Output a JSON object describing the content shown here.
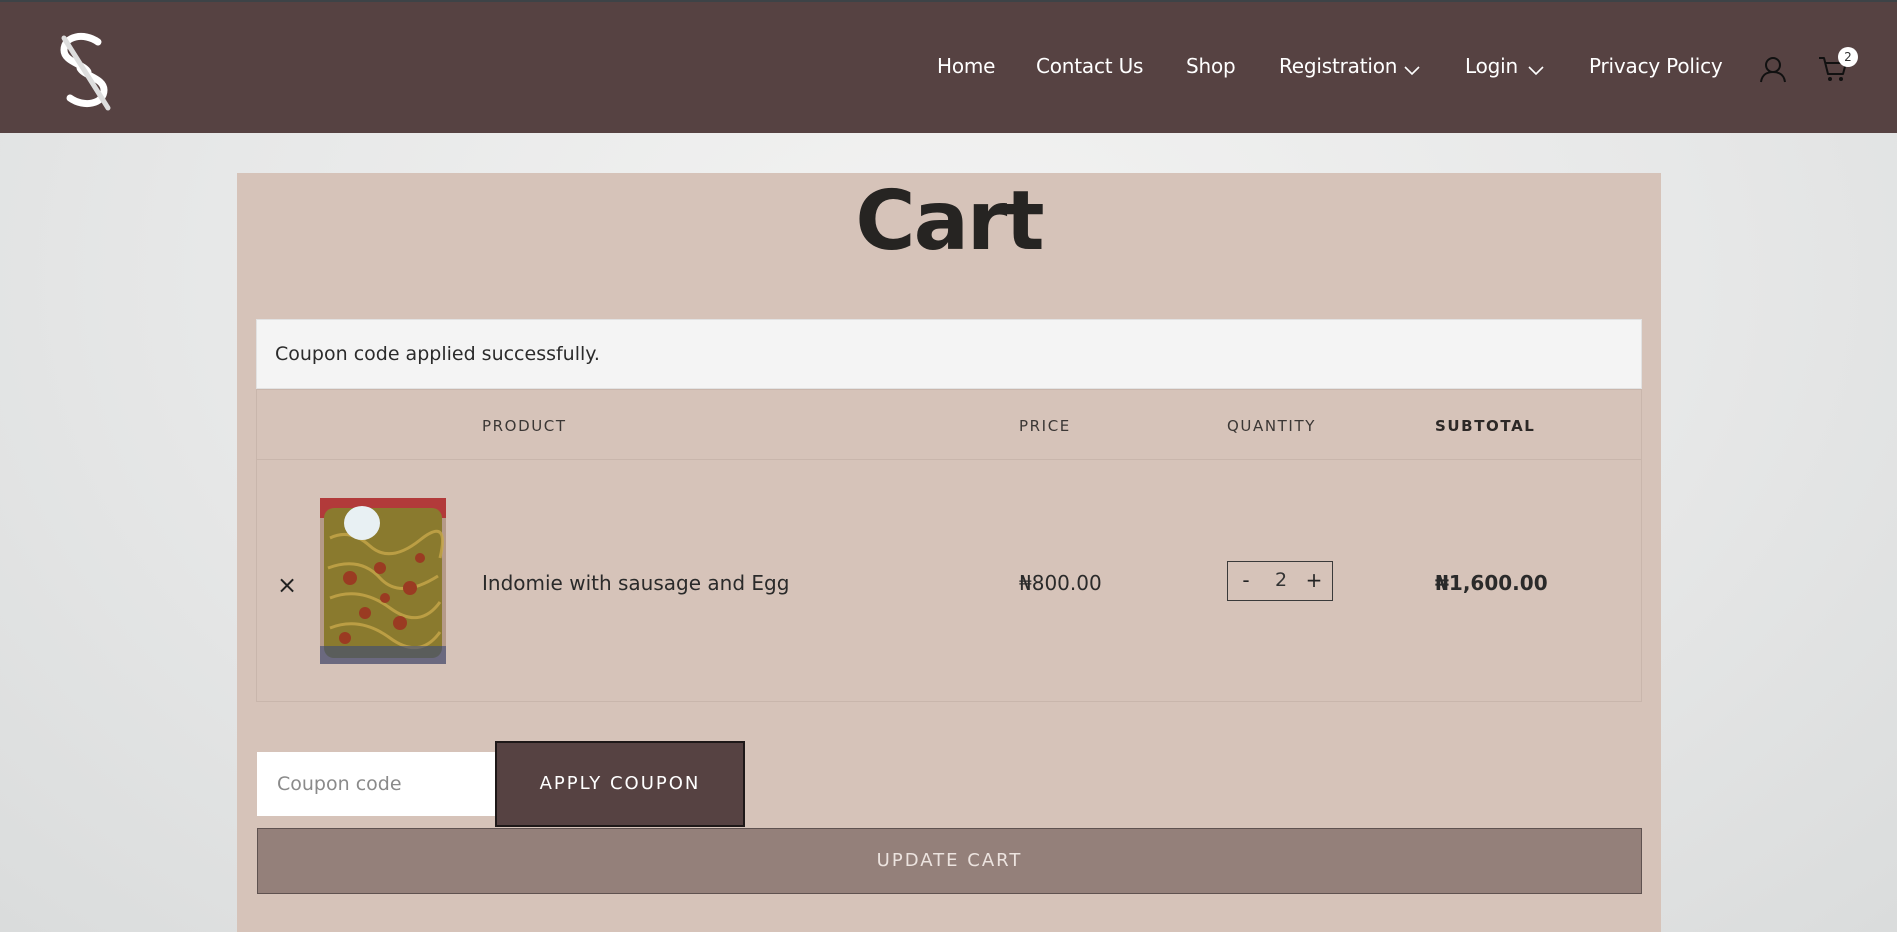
{
  "header": {
    "logo_icon": "brand-logo-icon",
    "nav": [
      {
        "label": "Home"
      },
      {
        "label": "Contact Us"
      },
      {
        "label": "Shop"
      },
      {
        "label": "Registration",
        "has_dropdown": true
      },
      {
        "label": "Login",
        "has_dropdown": true
      },
      {
        "label": "Privacy Policy"
      }
    ],
    "account_icon": "user-icon",
    "cart_icon": "cart-icon",
    "cart_count": "2",
    "bg_color": "#564242"
  },
  "page": {
    "title": "Cart"
  },
  "notice": {
    "message": "Coupon code applied successfully."
  },
  "table": {
    "headers": {
      "product": "PRODUCT",
      "price": "PRICE",
      "quantity": "QUANTITY",
      "subtotal": "SUBTOTAL"
    },
    "rows": [
      {
        "remove": "×",
        "name": "Indomie with sausage and Egg",
        "price": "₦800.00",
        "qty_minus": "-",
        "quantity": "2",
        "qty_plus": "+",
        "subtotal": "₦1,600.00"
      }
    ]
  },
  "coupon": {
    "placeholder": "Coupon code",
    "apply_label": "APPLY COUPON"
  },
  "update_label": "UPDATE CART"
}
